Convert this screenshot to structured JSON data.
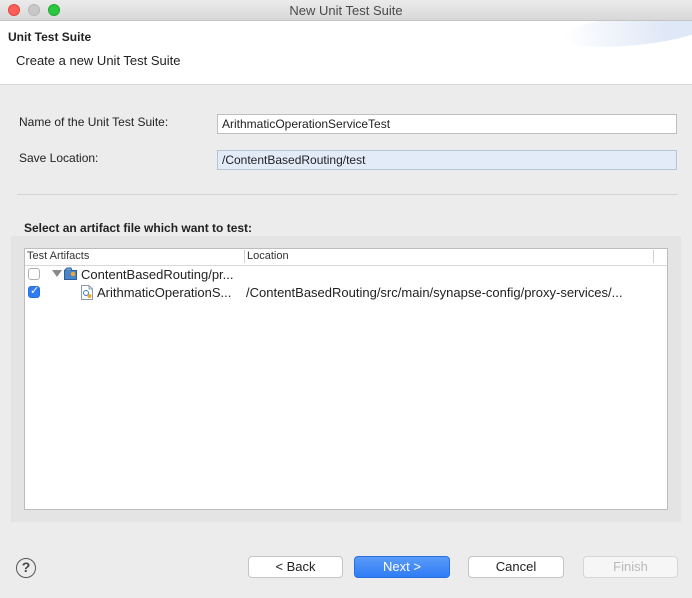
{
  "window": {
    "title": "New Unit Test Suite"
  },
  "header": {
    "title": "Unit Test Suite",
    "description": "Create a new Unit Test Suite"
  },
  "form": {
    "name_label": "Name of the Unit Test Suite:",
    "name_value": "ArithmaticOperationServiceTest",
    "location_label": "Save Location:",
    "location_value": "/ContentBasedRouting/test"
  },
  "artifacts": {
    "group_label": "Select an artifact file which want to test:",
    "columns": [
      "Test Artifacts",
      "Location"
    ],
    "rows": [
      {
        "name": "ContentBasedRouting/pr...",
        "location": "",
        "checked": false,
        "icon": "project-icon"
      },
      {
        "name": "ArithmaticOperationS...",
        "location": "/ContentBasedRouting/src/main/synapse-config/proxy-services/...",
        "checked": true,
        "icon": "proxy-service-file-icon"
      }
    ]
  },
  "buttons": {
    "back": "< Back",
    "next": "Next >",
    "cancel": "Cancel",
    "finish": "Finish",
    "help": "?"
  }
}
